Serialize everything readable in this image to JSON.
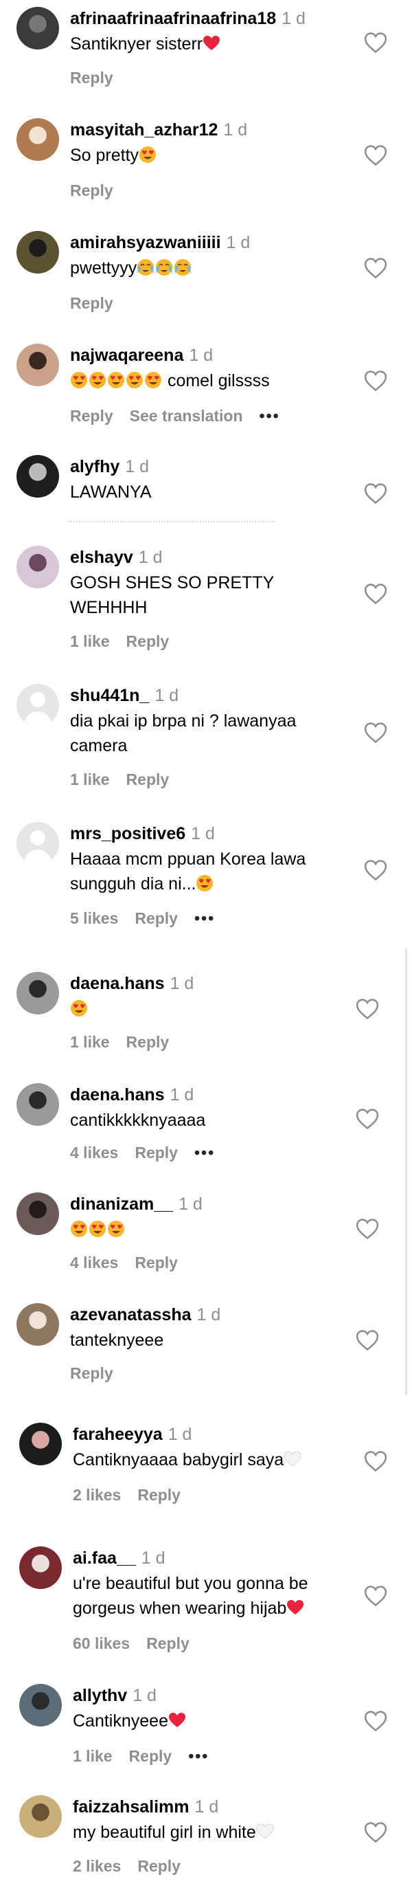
{
  "comments": [
    {
      "user": "afrinaafrinaafrinaafrina18",
      "time": "1 d",
      "text": "Santiknyer sisterr",
      "likes": "",
      "reply": "Reply",
      "see_translation": "",
      "more": false,
      "avatar": {
        "type": "photo",
        "color": "#3a3a3a",
        "accent": "#777"
      }
    },
    {
      "user": "masyitah_azhar12",
      "time": "1 d",
      "text": "So pretty",
      "likes": "",
      "reply": "Reply",
      "see_translation": "",
      "more": false,
      "avatar": {
        "type": "photo",
        "color": "#b07a52",
        "accent": "#f1e3cf"
      }
    },
    {
      "user": "amirahsyazwaniiiii",
      "time": "1 d",
      "text": "pwettyyy",
      "likes": "",
      "reply": "Reply",
      "see_translation": "",
      "more": false,
      "avatar": {
        "type": "photo",
        "color": "#5a5230",
        "accent": "#1d1d1d"
      }
    },
    {
      "user": "najwaqareena",
      "time": "1 d",
      "text": "comel gilssss",
      "likes": "",
      "reply": "Reply",
      "see_translation": "See translation",
      "more": true,
      "avatar": {
        "type": "photo",
        "color": "#caa28c",
        "accent": "#3a2820"
      }
    },
    {
      "user": "alyfhy",
      "time": "1 d",
      "text": "LAWANYA",
      "likes": "",
      "reply": "",
      "see_translation": "",
      "more": false,
      "avatar": {
        "type": "photo",
        "color": "#1e1e1e",
        "accent": "#bbbbbb"
      }
    },
    {
      "user": "elshayv",
      "time": "1 d",
      "text": "GOSH SHES SO PRETTY\nWEHHHH",
      "likes": "1 like",
      "reply": "Reply",
      "see_translation": "",
      "more": false,
      "avatar": {
        "type": "photo",
        "color": "#d9c7d8",
        "accent": "#6b4a5f"
      }
    },
    {
      "user": "shu441n_",
      "time": "1 d",
      "text": "dia pkai ip brpa ni ? lawanyaa\ncamera",
      "likes": "1 like",
      "reply": "Reply",
      "see_translation": "",
      "more": false,
      "avatar": {
        "type": "placeholder",
        "color": "#e6e6e6",
        "accent": "#ffffff"
      }
    },
    {
      "user": "mrs_positive6",
      "time": "1 d",
      "text": "Haaaa mcm ppuan Korea lawa\nsungguh dia ni...",
      "likes": "5 likes",
      "reply": "Reply",
      "see_translation": "",
      "more": true,
      "avatar": {
        "type": "placeholder",
        "color": "#e6e6e6",
        "accent": "#ffffff"
      }
    },
    {
      "user": "daena.hans",
      "time": "1 d",
      "text": "",
      "likes": "1 like",
      "reply": "Reply",
      "see_translation": "",
      "more": false,
      "avatar": {
        "type": "photo",
        "color": "#9a9a9a",
        "accent": "#2a2a2a"
      }
    },
    {
      "user": "daena.hans",
      "time": "1 d",
      "text": "cantikkkkknyaaaa",
      "likes": "4 likes",
      "reply": "Reply",
      "see_translation": "",
      "more": true,
      "avatar": {
        "type": "photo",
        "color": "#9a9a9a",
        "accent": "#2a2a2a"
      }
    },
    {
      "user": "dinanizam__",
      "time": "1 d",
      "text": "",
      "likes": "4 likes",
      "reply": "Reply",
      "see_translation": "",
      "more": false,
      "avatar": {
        "type": "photo",
        "color": "#6b5a58",
        "accent": "#231c1c"
      }
    },
    {
      "user": "azevanatassha",
      "time": "1 d",
      "text": "tanteknyeee",
      "likes": "",
      "reply": "Reply",
      "see_translation": "",
      "more": false,
      "avatar": {
        "type": "photo",
        "color": "#8f7660",
        "accent": "#efe2d6"
      }
    },
    {
      "user": "faraheeyya",
      "time": "1 d",
      "text": "Cantiknyaaaa babygirl saya",
      "likes": "2 likes",
      "reply": "Reply",
      "see_translation": "",
      "more": false,
      "avatar": {
        "type": "photo",
        "color": "#1c1c1c",
        "accent": "#d9a7a0"
      }
    },
    {
      "user": "ai.faa__",
      "time": "1 d",
      "text": "u're beautiful but you gonna be\ngorgeus when wearing hijab",
      "likes": "60 likes",
      "reply": "Reply",
      "see_translation": "",
      "more": false,
      "avatar": {
        "type": "photo",
        "color": "#7a2a2e",
        "accent": "#e9e0de"
      }
    },
    {
      "user": "allythv",
      "time": "1 d",
      "text": "Cantiknyeee",
      "likes": "1 like",
      "reply": "Reply",
      "see_translation": "",
      "more": true,
      "avatar": {
        "type": "photo",
        "color": "#5b6d78",
        "accent": "#2b2b2b"
      }
    },
    {
      "user": "faizzahsalimm",
      "time": "1 d",
      "text": "my beautiful girl in white",
      "likes": "2 likes",
      "reply": "Reply",
      "see_translation": "",
      "more": false,
      "avatar": {
        "type": "photo",
        "color": "#c9b07a",
        "accent": "#6a5334"
      }
    }
  ],
  "colors": {
    "heart_red": "#ed2a3a",
    "emoji_face": "#f7b52a",
    "emoji_heart": "#e8243c",
    "muted": "#8e8e8e",
    "white_heart": "#d8d8d8"
  }
}
